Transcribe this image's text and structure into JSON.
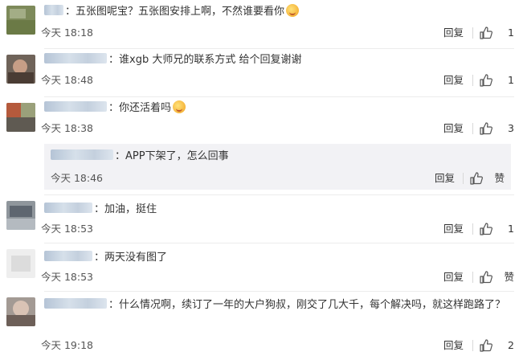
{
  "comments": [
    {
      "text": "五张图呢宝？五张图安排上啊，不然谁要看你",
      "emoji": "smiling-face-emoji",
      "time": "今天 18:18",
      "reply": "回复",
      "likes": "1"
    },
    {
      "text": "谁xgb 大师兄的联系方式 给个回复谢谢",
      "time": "今天 18:48",
      "reply": "回复",
      "likes": "1"
    },
    {
      "text": "你还活着吗",
      "emoji": "thinking-face-emoji",
      "time": "今天 18:38",
      "reply": "回复",
      "likes": "3"
    },
    {
      "text": "加油，挺住",
      "time": "今天 18:53",
      "reply": "回复",
      "likes": "1"
    },
    {
      "text": "两天没有图了",
      "time": "今天 18:53",
      "reply": "回复",
      "likes": "赞"
    },
    {
      "text": "什么情况啊，续订了一年的大户狗叔，刚交了几大千，每个解决吗，就这样跑路了？",
      "time": "今天 19:18",
      "reply": "回复",
      "likes": "2"
    }
  ],
  "subreply": {
    "text": "APP下架了，怎么回事",
    "time": "今天 18:46",
    "reply": "回复",
    "likes": "赞"
  },
  "colon": "：",
  "colors": {
    "background": "#ffffff",
    "subreply_bg": "#f2f2f5",
    "text": "#333333",
    "blurred_name": "#c4d0de"
  }
}
